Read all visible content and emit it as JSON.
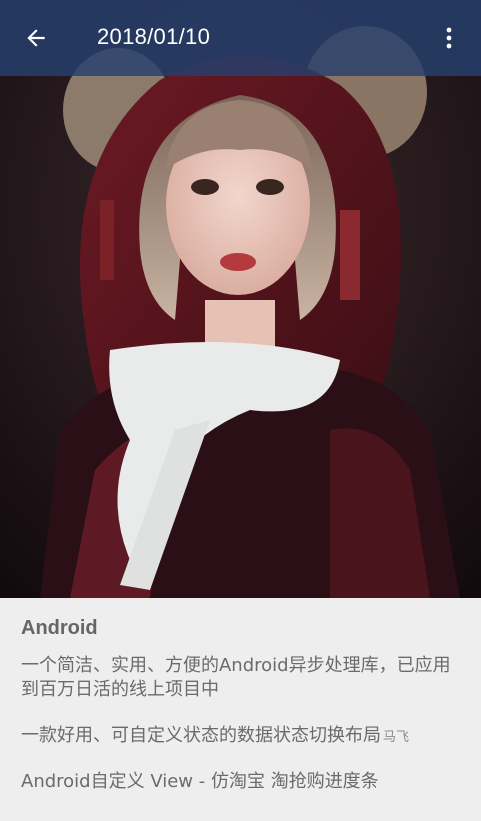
{
  "toolbar": {
    "title": "2018/01/10",
    "back_icon": "arrow-back-icon",
    "menu_icon": "more-vert-icon",
    "background": "#26406e"
  },
  "hero": {
    "image": "cosplay-portrait-photo"
  },
  "content": {
    "heading": "Android",
    "items": [
      {
        "text": "一个简洁、实用、方便的Android异步处理库，已应用到百万日活的线上项目中"
      },
      {
        "text": "一款好用、可自定义状态的数据状态切换布局",
        "author": "马飞"
      },
      {
        "text": "Android自定义 View - 仿淘宝 淘抢购进度条"
      }
    ]
  }
}
